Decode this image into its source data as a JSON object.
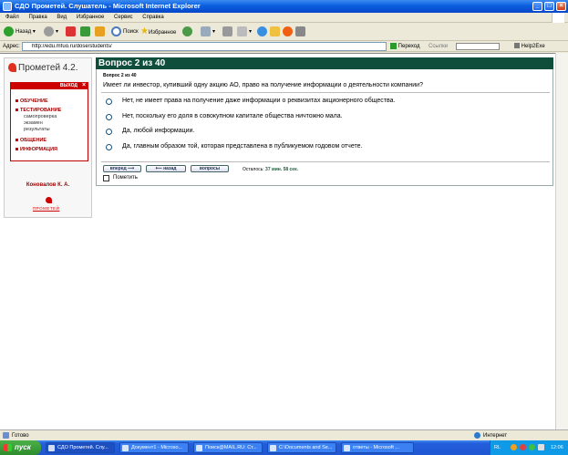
{
  "window": {
    "title": "СДО Прометей. Слушатель - Microsoft Internet Explorer"
  },
  "menu": [
    "Файл",
    "Правка",
    "Вид",
    "Избранное",
    "Сервис",
    "Справка"
  ],
  "toolbar": {
    "back": "Назад",
    "search": "Поиск",
    "favorites": "Избранное"
  },
  "address": {
    "label": "Адрес:",
    "url": "http://edu.mfuo.ru/dose/students/",
    "go": "Переход",
    "links": "Ссылки",
    "ext": "Help2Exe Emulator"
  },
  "sidebar": {
    "logo": "Прометей 4.2.",
    "exit": "ВЫХОД",
    "nav": [
      {
        "label": "ОБУЧЕНИЕ"
      },
      {
        "label": "ТЕСТИРОВАНИЕ"
      },
      {
        "label": "ОБЩЕНИЕ"
      },
      {
        "label": "ИНФОРМАЦИЯ"
      }
    ],
    "testing_sub": [
      "самопроверка",
      "экзамен",
      "результаты"
    ],
    "user": "Коновалов К. А.",
    "footer_logo": "ПРОМЕТЕЙ"
  },
  "question": {
    "header": "Вопрос 2 из 40",
    "small": "Вопрос 2 из 40",
    "text": "Имеет ли инвестор, купивший одну акцию АО, право на получение информации о деятельности компании?",
    "options": [
      "Нет, не имеет права на получение даже информации о реквизитах акционерного общества.",
      "Нет, поскольку его доля в совокупном капитале общества ничтожно мала.",
      "Да, любой информации.",
      "Да, главным образом той, которая представлена в публикуемом годовом отчете."
    ],
    "forward": "вперед",
    "back": "назад",
    "questions": "вопросы",
    "remaining_label": "Осталось:",
    "remaining_value": "37 мин. 58 сек.",
    "mark_label": "Пометить"
  },
  "status": {
    "left": "Готово",
    "zone": "Интернет"
  },
  "taskbar": {
    "start": "пуск",
    "tasks": [
      "СДО Прометей. Слу...",
      "Документ1 - Microso...",
      "Поиск@MAIL.RU: Ст...",
      "C:\\Documents and Se...",
      "ответы - Microsoft ..."
    ],
    "lang": "RL",
    "clock": "12:06"
  }
}
